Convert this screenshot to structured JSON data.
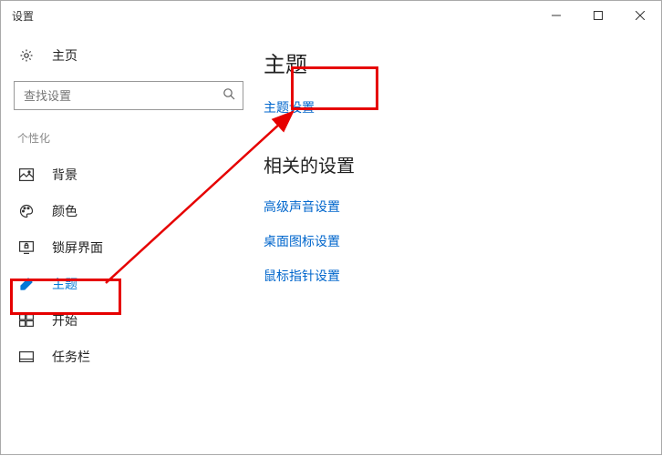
{
  "window": {
    "title": "设置"
  },
  "sidebar": {
    "home_label": "主页",
    "search_placeholder": "查找设置",
    "section_label": "个性化",
    "items": [
      {
        "label": "背景"
      },
      {
        "label": "颜色"
      },
      {
        "label": "锁屏界面"
      },
      {
        "label": "主题"
      },
      {
        "label": "开始"
      },
      {
        "label": "任务栏"
      }
    ]
  },
  "main": {
    "heading": "主题",
    "theme_settings_link": "主题设置",
    "related_heading": "相关的设置",
    "related_links": [
      "高级声音设置",
      "桌面图标设置",
      "鼠标指针设置"
    ]
  },
  "annotation": {
    "highlight_color": "#e60000"
  }
}
